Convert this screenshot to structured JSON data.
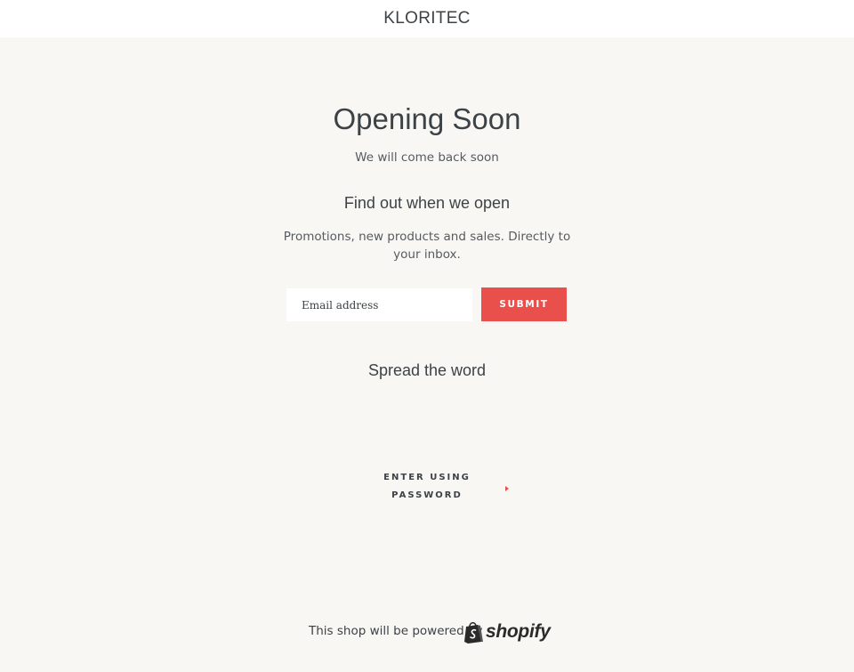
{
  "header": {
    "brand": "KLORITEC"
  },
  "main": {
    "title": "Opening Soon",
    "subtitle": "We will come back soon",
    "signup": {
      "heading": "Find out when we open",
      "description": "Promotions, new products and sales. Directly to your inbox.",
      "email_placeholder": "Email address",
      "submit_label": "SUBMIT"
    },
    "share": {
      "heading": "Spread the word"
    },
    "password_link": {
      "line1": "ENTER USING",
      "line2": "PASSWORD",
      "icon": "arrow-right-icon"
    }
  },
  "footer": {
    "powered_text": "This shop will be powered by",
    "logo_text": "shopify",
    "logo_icon": "shopify-bag-icon"
  },
  "colors": {
    "background": "#f8f7f4",
    "header_background": "#ffffff",
    "accent": "#e9504c",
    "text": "#3d4246"
  }
}
